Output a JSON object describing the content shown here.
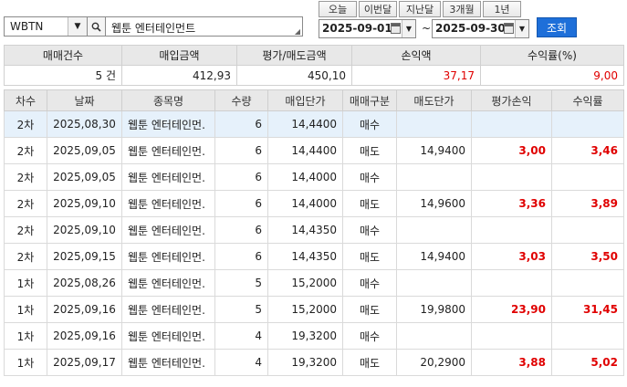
{
  "filter": {
    "ticker": "WBTN",
    "name": "웹툰 엔터테인먼트",
    "periods": [
      "오늘",
      "이번달",
      "지난달",
      "3개월",
      "1년"
    ],
    "start_date": "2025-09-01",
    "end_date": "2025-09-30",
    "tilde": "~",
    "query_label": "조회"
  },
  "summary": {
    "headers": [
      "매매건수",
      "매입금액",
      "평가/매도금액",
      "손익액",
      "수익률(%)"
    ],
    "values": [
      "5 건",
      "412,93",
      "450,10",
      "37,17",
      "9,00"
    ]
  },
  "grid": {
    "headers": [
      "차수",
      "날짜",
      "종목명",
      "수량",
      "매입단가",
      "매매구분",
      "매도단가",
      "평가손익",
      "수익률"
    ],
    "rows": [
      {
        "round": "2차",
        "date": "2025,08,30",
        "name": "웹툰 엔터테인먼.",
        "qty": "6",
        "buy": "14,4400",
        "type": "매수",
        "sell": "",
        "pl": "",
        "ret": ""
      },
      {
        "round": "2차",
        "date": "2025,09,05",
        "name": "웹툰 엔터테인먼.",
        "qty": "6",
        "buy": "14,4400",
        "type": "매도",
        "sell": "14,9400",
        "pl": "3,00",
        "ret": "3,46"
      },
      {
        "round": "2차",
        "date": "2025,09,05",
        "name": "웹툰 엔터테인먼.",
        "qty": "6",
        "buy": "14,4000",
        "type": "매수",
        "sell": "",
        "pl": "",
        "ret": ""
      },
      {
        "round": "2차",
        "date": "2025,09,10",
        "name": "웹툰 엔터테인먼.",
        "qty": "6",
        "buy": "14,4000",
        "type": "매도",
        "sell": "14,9600",
        "pl": "3,36",
        "ret": "3,89"
      },
      {
        "round": "2차",
        "date": "2025,09,10",
        "name": "웹툰 엔터테인먼.",
        "qty": "6",
        "buy": "14,4350",
        "type": "매수",
        "sell": "",
        "pl": "",
        "ret": ""
      },
      {
        "round": "2차",
        "date": "2025,09,15",
        "name": "웹툰 엔터테인먼.",
        "qty": "6",
        "buy": "14,4350",
        "type": "매도",
        "sell": "14,9400",
        "pl": "3,03",
        "ret": "3,50"
      },
      {
        "round": "1차",
        "date": "2025,08,26",
        "name": "웹툰 엔터테인먼.",
        "qty": "5",
        "buy": "15,2000",
        "type": "매수",
        "sell": "",
        "pl": "",
        "ret": ""
      },
      {
        "round": "1차",
        "date": "2025,09,16",
        "name": "웹툰 엔터테인먼.",
        "qty": "5",
        "buy": "15,2000",
        "type": "매도",
        "sell": "19,9800",
        "pl": "23,90",
        "ret": "31,45"
      },
      {
        "round": "1차",
        "date": "2025,09,16",
        "name": "웹툰 엔터테인먼.",
        "qty": "4",
        "buy": "19,3200",
        "type": "매수",
        "sell": "",
        "pl": "",
        "ret": ""
      },
      {
        "round": "1차",
        "date": "2025,09,17",
        "name": "웹툰 엔터테인먼.",
        "qty": "4",
        "buy": "19,3200",
        "type": "매도",
        "sell": "20,2900",
        "pl": "3,88",
        "ret": "5,02"
      }
    ]
  },
  "colors": {
    "accent": "#1e6fd9",
    "profit": "#e00000",
    "header_bg": "#e8e8e8",
    "selected_row": "#e6f1fb"
  }
}
